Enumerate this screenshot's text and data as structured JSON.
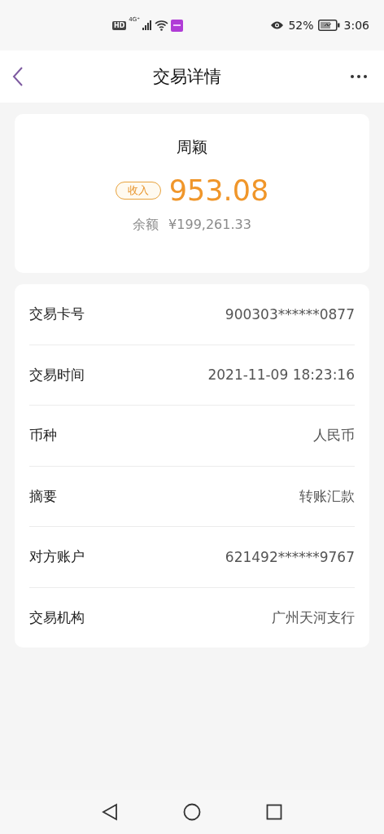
{
  "status_bar": {
    "network_badge": "HD",
    "network_type": "4G⁺",
    "battery_percent": "52%",
    "time": "3:06"
  },
  "header": {
    "title": "交易详情"
  },
  "summary": {
    "name": "周颖",
    "direction_tag": "收入",
    "amount": "953.08",
    "balance_label": "余额",
    "balance": "¥199,261.33"
  },
  "details": [
    {
      "label": "交易卡号",
      "value": "900303******0877"
    },
    {
      "label": "交易时间",
      "value": "2021-11-09 18:23:16"
    },
    {
      "label": "币种",
      "value": "人民币"
    },
    {
      "label": "摘要",
      "value": "转账汇款"
    },
    {
      "label": "对方账户",
      "value": "621492******9767"
    },
    {
      "label": "交易机构",
      "value": "广州天河支行"
    }
  ]
}
